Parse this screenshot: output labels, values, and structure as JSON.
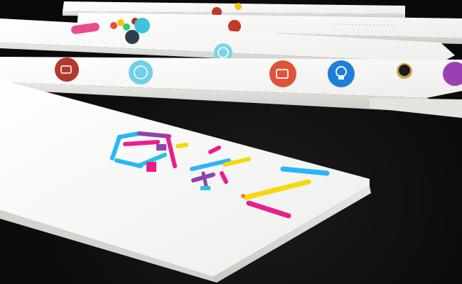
{
  "scene": {
    "background": "#0f0f10",
    "board_color": "#f5f5f3",
    "board_edge_color": "#d9d9d6",
    "sticks": [
      {
        "name": "back-stick-1",
        "icons": [
          {
            "name": "red-circle-icon",
            "color": "#c0392b"
          },
          {
            "name": "yellow-circle-icon",
            "color": "#f1c40f"
          }
        ]
      },
      {
        "name": "back-stick-2",
        "icons": [
          {
            "name": "red-circle-icon",
            "color": "#c23a2c"
          },
          {
            "name": "red-circle-icon",
            "color": "#b5332a"
          }
        ]
      },
      {
        "name": "back-stick-3",
        "icons": [
          {
            "name": "pink-pill-icon",
            "color": "#e84c8b"
          },
          {
            "name": "multicolor-flower-icon",
            "color": "#e74c3c"
          },
          {
            "name": "cyan-circle-icon",
            "color": "#3fc4d9"
          },
          {
            "name": "dark-circle-icon",
            "color": "#2c3e50"
          },
          {
            "name": "cyan-circle-icon",
            "color": "#7fd3e6"
          }
        ]
      },
      {
        "name": "middle-stick",
        "icons": [
          {
            "name": "coffee-circle-icon",
            "color": "#b13a2e"
          },
          {
            "name": "lightblue-circle-icon",
            "color": "#6fd0e8"
          },
          {
            "name": "cup-circle-icon",
            "color": "#e0533a"
          },
          {
            "name": "blue-circle-icon",
            "color": "#1f7fd8"
          },
          {
            "name": "magnet-icon",
            "color": "#c9a24a"
          },
          {
            "name": "purple-circle-icon",
            "color": "#9b3fb5"
          }
        ]
      }
    ],
    "logo": {
      "name": "colorful-logo-glyphs",
      "colors": [
        "#8e44ad",
        "#e91e8c",
        "#29b6f6",
        "#f5d90a",
        "#26c6da",
        "#ff7043"
      ]
    }
  }
}
